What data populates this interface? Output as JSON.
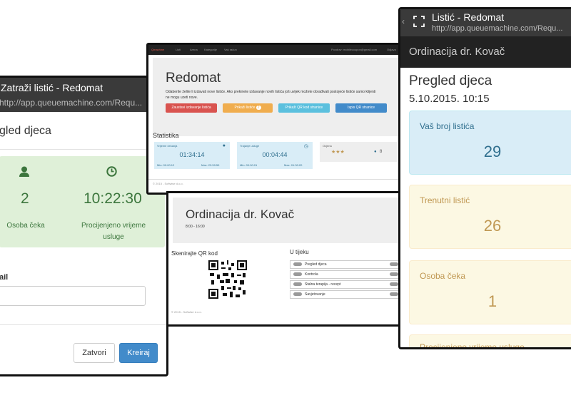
{
  "left_phone": {
    "chrome_title": "Zatraži listić - Redomat",
    "chrome_url": "http://app.queuemachine.com/Requ...",
    "modal_title": "gled djeca",
    "waiting_count": "2",
    "waiting_label": "Osoba čeka",
    "estimated_time": "10:22:30",
    "estimated_label": "Procijenjeno vrijeme usluge",
    "email_label": "ail",
    "close_button": "Zatvori",
    "create_button": "Kreiraj",
    "icons": {
      "person": "user-icon",
      "clock": "clock-icon"
    },
    "colors": {
      "success_bg": "#dff0d8",
      "success_text": "#3c763d",
      "primary": "#428bca"
    }
  },
  "desktop": {
    "nav_brand": "Qmachine",
    "nav_items": [
      "Listi",
      "Arena",
      "Kategorije",
      "Vaš račun"
    ],
    "nav_user": "Pozdrav: mobilecoupon@gmail.com",
    "nav_logout": "Odjava",
    "title": "Redomat",
    "description": "Odaberite želite li izdavati nove listiće. Ako prekinete izdavanje novih listića još uvijek možete obrađivati postojeće listiće samo klijenti ne mogu uzeti nove.",
    "buttons": [
      "Zaustavi izdavanje listića",
      "Prikaži listiće",
      "Prikaži QR kod stranice",
      "Ispis QR stranice"
    ],
    "badge": "2",
    "stats_title": "Statistika",
    "stat_wait_label": "Vrijeme čekanja",
    "stat_wait_value": "01:34:14",
    "stat_wait_min": "Min: 00:00:12",
    "stat_wait_max": "Max: 23:59:59",
    "stat_service_label": "Trajanje usluge",
    "stat_service_value": "00:04:44",
    "stat_service_min": "Min: 00:00:01",
    "stat_service_max": "Max: 01:30:20",
    "stat_rating_label": "Ocjena",
    "stat_rating_stars": "★★★",
    "stat_rating_count": "8",
    "footer": "© 2015 - Softwise d.o.o."
  },
  "lower": {
    "title": "Ordinacija dr. Kovač",
    "hours": "8:00 - 16:00",
    "qr_label": "Skenirajte QR kod",
    "in_progress_label": "U tijeku",
    "items": [
      "Pregled djeca",
      "Kontrola",
      "Stalna terapija - recept",
      "Savjetovanje"
    ],
    "footer": "© 2015 - Softwise d.o.o."
  },
  "right_phone": {
    "chrome_title": "Listić - Redomat",
    "chrome_url": "http://app.queuemachine.com/Requ...",
    "header": "Ordinacija dr. Kovač",
    "page_title": "Pregled djeca",
    "datetime": "5.10.2015. 10:15",
    "your_ticket_label": "Vaš broj listića",
    "your_ticket_value": "29",
    "current_ticket_label": "Trenutni listić",
    "current_ticket_value": "26",
    "waiting_label": "Osoba čeka",
    "waiting_value": "1",
    "estimated_label": "Procijenjeno vrijeme usluge",
    "colors": {
      "info_bg": "#d9edf7",
      "info_text": "#31708f",
      "warning_bg": "#fcf8e3",
      "warning_text": "#c09853"
    }
  }
}
